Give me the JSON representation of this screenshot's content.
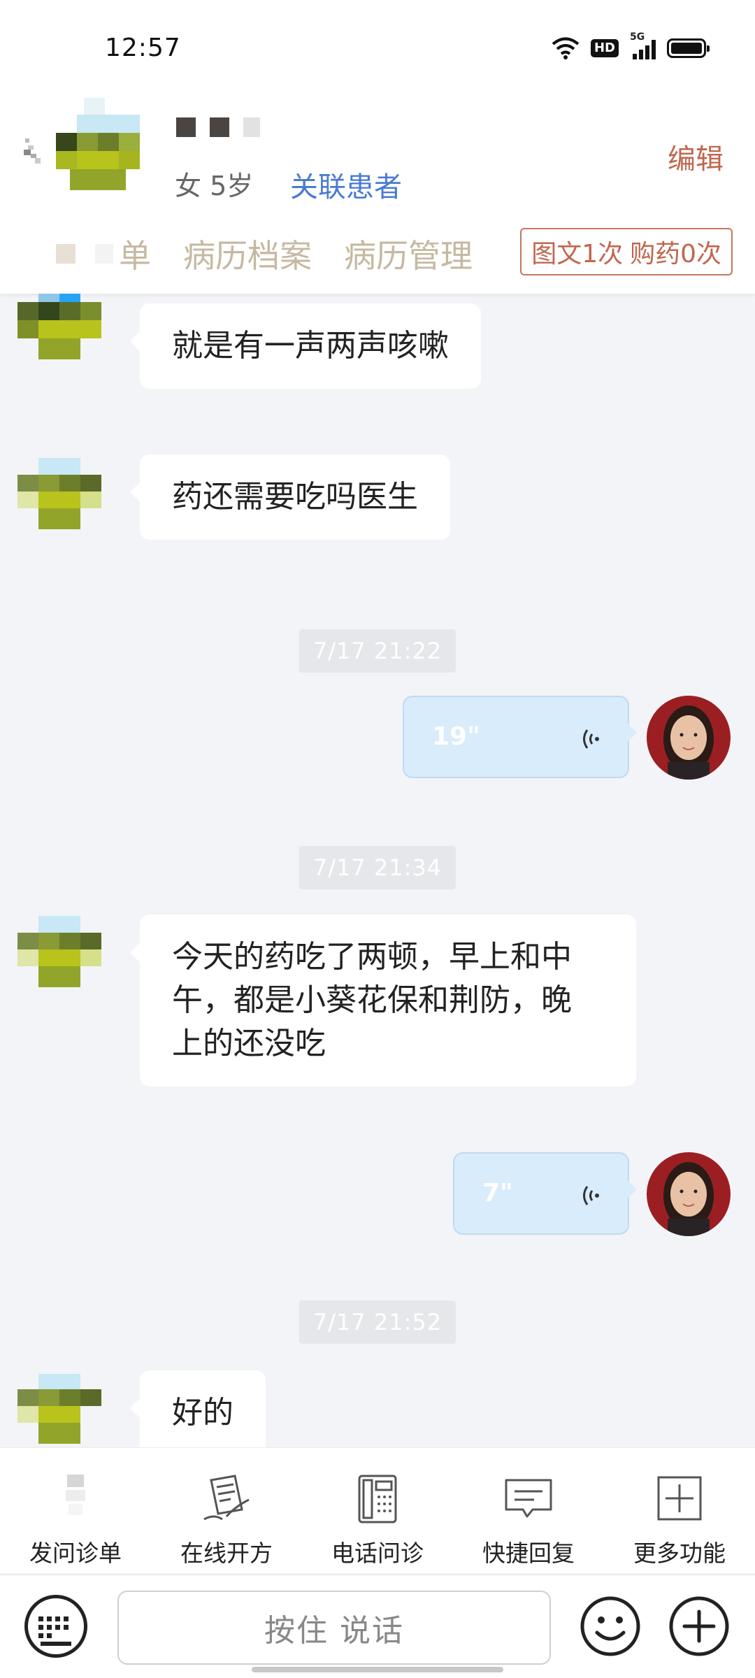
{
  "status_bar": {
    "time": "12:57",
    "network": "5G",
    "hd_badge": "HD"
  },
  "header": {
    "patient_info": "女 5岁",
    "link_patient": "关联患者",
    "edit": "编辑",
    "tabs": [
      "单",
      "病历档案",
      "病历管理"
    ],
    "consult_count": "图文1次",
    "purchase_count": "购药0次"
  },
  "messages": [
    {
      "type": "text",
      "side": "left",
      "text": "就是有一声两声咳嗽"
    },
    {
      "type": "text",
      "side": "left",
      "text": "药还需要吃吗医生"
    },
    {
      "type": "time",
      "text": "7/17 21:22"
    },
    {
      "type": "voice",
      "side": "right",
      "duration": "19\""
    },
    {
      "type": "time",
      "text": "7/17 21:34"
    },
    {
      "type": "text",
      "side": "left",
      "lines": [
        "今天的药吃了两顿，早上和中",
        "午，都是小葵花保和荆防，晚",
        "上的还没吃"
      ]
    },
    {
      "type": "voice",
      "side": "right",
      "duration": "7\""
    },
    {
      "type": "time",
      "text": "7/17 21:52"
    },
    {
      "type": "text",
      "side": "left",
      "text": "好的"
    }
  ],
  "toolbar": {
    "items": [
      {
        "label": "发问诊单",
        "icon": "questionnaire-icon"
      },
      {
        "label": "在线开方",
        "icon": "prescription-icon"
      },
      {
        "label": "电话问诊",
        "icon": "phone-icon"
      },
      {
        "label": "快捷回复",
        "icon": "quick-reply-icon"
      },
      {
        "label": "更多功能",
        "icon": "more-functions-icon"
      }
    ]
  },
  "input_bar": {
    "hold_to_talk": "按住 说话"
  },
  "colors": {
    "accent": "#c0674e",
    "link": "#4a7bd4",
    "voice_bubble": "#d9ecfb",
    "chat_bg": "#f3f4f8"
  }
}
